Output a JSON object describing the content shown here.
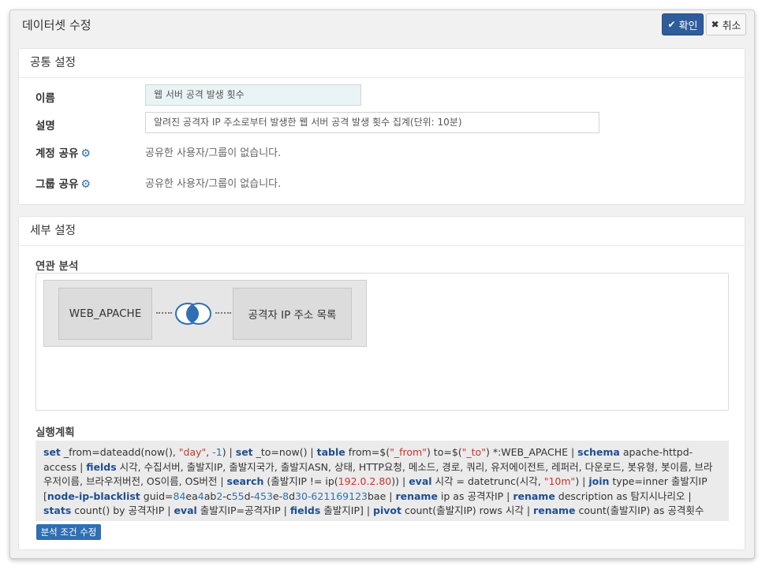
{
  "dialog": {
    "title": "데이터셋 수정",
    "ok_label": "확인",
    "cancel_label": "취소"
  },
  "common": {
    "title": "공통 설정",
    "name_label": "이름",
    "name_value": "웹 서버 공격 발생 횟수",
    "desc_label": "설명",
    "desc_value": "알려진 공격자 IP 주소로부터 발생한 웹 서버 공격 발생 횟수 집계(단위: 10분)",
    "account_share_label": "계정 공유",
    "account_share_value": "공유한 사용자/그룹이 없습니다.",
    "group_share_label": "그룹 공유",
    "group_share_value": "공유한 사용자/그룹이 없습니다."
  },
  "detail": {
    "title": "세부 설정",
    "relation_label": "연관 분석",
    "left_node": "WEB_APACHE",
    "right_node": "공격자 IP 주소 목록",
    "plan_label": "실행계획",
    "edit_button": "분석 조건 수정",
    "plan_tokens": [
      {
        "t": "kw",
        "v": "set"
      },
      {
        "t": "txt",
        "v": " _from=dateadd(now(), "
      },
      {
        "t": "str",
        "v": "\"day\""
      },
      {
        "t": "txt",
        "v": ", "
      },
      {
        "t": "num",
        "v": "-1"
      },
      {
        "t": "txt",
        "v": ") | "
      },
      {
        "t": "kw",
        "v": "set"
      },
      {
        "t": "txt",
        "v": " _to=now() | "
      },
      {
        "t": "kw",
        "v": "table"
      },
      {
        "t": "txt",
        "v": " from=$("
      },
      {
        "t": "str",
        "v": "\"_from\""
      },
      {
        "t": "txt",
        "v": ") to=$("
      },
      {
        "t": "str",
        "v": "\"_to\""
      },
      {
        "t": "txt",
        "v": ") *:WEB_APACHE | "
      },
      {
        "t": "kw",
        "v": "schema"
      },
      {
        "t": "txt",
        "v": " apache-httpd-access | "
      },
      {
        "t": "kw",
        "v": "fields"
      },
      {
        "t": "txt",
        "v": " 시각, 수집서버, 출발지IP, 출발지국가, 출발지ASN, 상태, HTTP요청, 메소드, 경로, 쿼리, 유저에이전트, 레퍼러, 다운로드, 봇유형, 봇이름, 브라우저이름, 브라우저버전, OS이름, OS버전  | "
      },
      {
        "t": "kw",
        "v": "search"
      },
      {
        "t": "txt",
        "v": " (출발지IP != ip("
      },
      {
        "t": "str",
        "v": "192.0.2.80"
      },
      {
        "t": "txt",
        "v": ")) | "
      },
      {
        "t": "kw",
        "v": "eval"
      },
      {
        "t": "txt",
        "v": " 시각 = datetrunc(시각, "
      },
      {
        "t": "str",
        "v": "\"10m\""
      },
      {
        "t": "txt",
        "v": ")  | "
      },
      {
        "t": "kw",
        "v": "join"
      },
      {
        "t": "txt",
        "v": " type=inner 출발지IP ["
      },
      {
        "t": "kw",
        "v": "node-ip-blacklist"
      },
      {
        "t": "txt",
        "v": " guid="
      },
      {
        "t": "num",
        "v": "84"
      },
      {
        "t": "txt",
        "v": "ea"
      },
      {
        "t": "num",
        "v": "4"
      },
      {
        "t": "txt",
        "v": "ab"
      },
      {
        "t": "num",
        "v": "2"
      },
      {
        "t": "txt",
        "v": "-c"
      },
      {
        "t": "num",
        "v": "55"
      },
      {
        "t": "txt",
        "v": "d-"
      },
      {
        "t": "num",
        "v": "453"
      },
      {
        "t": "txt",
        "v": "e-"
      },
      {
        "t": "num",
        "v": "8"
      },
      {
        "t": "txt",
        "v": "d"
      },
      {
        "t": "num",
        "v": "30-621169123"
      },
      {
        "t": "txt",
        "v": "bae | "
      },
      {
        "t": "kw",
        "v": "rename"
      },
      {
        "t": "txt",
        "v": " ip as 공격자IP | "
      },
      {
        "t": "kw",
        "v": "rename"
      },
      {
        "t": "txt",
        "v": " description as 탐지시나리오 | "
      },
      {
        "t": "kw",
        "v": "stats"
      },
      {
        "t": "txt",
        "v": " count() by 공격자IP | "
      },
      {
        "t": "kw",
        "v": "eval"
      },
      {
        "t": "txt",
        "v": " 출발지IP=공격자IP | "
      },
      {
        "t": "kw",
        "v": "fields"
      },
      {
        "t": "txt",
        "v": " 출발지IP] | "
      },
      {
        "t": "kw",
        "v": "pivot"
      },
      {
        "t": "txt",
        "v": " count(출발지IP) rows 시각 | "
      },
      {
        "t": "kw",
        "v": "rename"
      },
      {
        "t": "txt",
        "v": " count(출발지IP) as 공격횟수"
      }
    ]
  },
  "colors": {
    "primary": "#2f5d9b",
    "keyword": "#1f4e91",
    "string": "#c0392b",
    "number": "#2f6fb3"
  },
  "icons": {
    "ok": "check-icon",
    "cancel": "times-icon",
    "share": "gear-icon",
    "join": "inner-join-icon"
  }
}
